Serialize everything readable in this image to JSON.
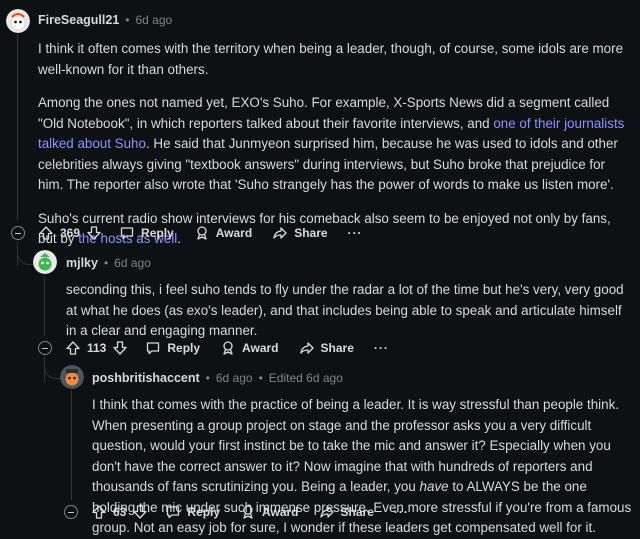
{
  "comments": [
    {
      "username": "FireSeagull21",
      "time": "6d ago",
      "paragraphs": [
        [
          "I think it often comes with the territory when being a leader, though, of course, some idols are more well-known for it than others."
        ],
        [
          "Among the ones not named yet, EXO's Suho. For example, X-Sports News did a segment called \"Old Notebook\", in which reporters talked about their favorite interviews, and ",
          "one of their journalists talked about Suho",
          ". He said that Junmyeon surprised him, because he was used to idols and other celebrities always giving \"textbook answers\" during interviews, but Suho broke that prejudice for him. The reporter also wrote that 'Suho strangely has the power of words to make us listen more'."
        ],
        [
          "Suho's current radio show interviews for his comeback also seem to be enjoyed not only by fans, but by ",
          "the hosts as well",
          "."
        ]
      ],
      "votes": "369",
      "reply_label": "Reply",
      "award_label": "Award",
      "share_label": "Share",
      "more_label": "···"
    },
    {
      "username": "mjlky",
      "time": "6d ago",
      "paragraphs": [
        [
          "seconding this, i feel suho tends to fly under the radar a lot of the time but he's very, very good at what he does (as exo's leader), and that includes being able to speak and articulate himself in a clear and engaging manner."
        ]
      ],
      "votes": "113",
      "reply_label": "Reply",
      "award_label": "Award",
      "share_label": "Share",
      "more_label": "···"
    },
    {
      "username": "poshbritishaccent",
      "time": "6d ago",
      "edited": "Edited 6d ago",
      "paragraphs": [
        [
          "I think that comes with the practice of being a leader. It is way stressful than people think. When presenting a group project on stage and the professor asks you a very difficult question, would your first instinct be to take the mic and answer it? Especially when you don't have the correct answer to it? Now imagine that with hundreds of reporters and thousands of fans scrutinizing you. Being a leader, you ",
          "have",
          " to ALWAYS be the one holding the mic under such immense pressure. Even more stressful if you're from a famous group. Not an easy job for sure, I wonder if these leaders get compensated well for it."
        ]
      ],
      "votes": "63",
      "reply_label": "Reply",
      "award_label": "Award",
      "share_label": "Share",
      "more_label": "···"
    }
  ],
  "separator": "•",
  "colors": {
    "background": "#0e1113",
    "text": "#d7dadc",
    "meta": "#818384",
    "link": "#8e91ff",
    "thread_line": "#343536"
  },
  "icons": [
    "avatar-fireseagull21",
    "avatar-mjlky",
    "avatar-poshbritishaccent",
    "collapse-icon",
    "upvote-icon",
    "downvote-icon",
    "reply-icon",
    "award-icon",
    "share-icon",
    "more-icon"
  ]
}
